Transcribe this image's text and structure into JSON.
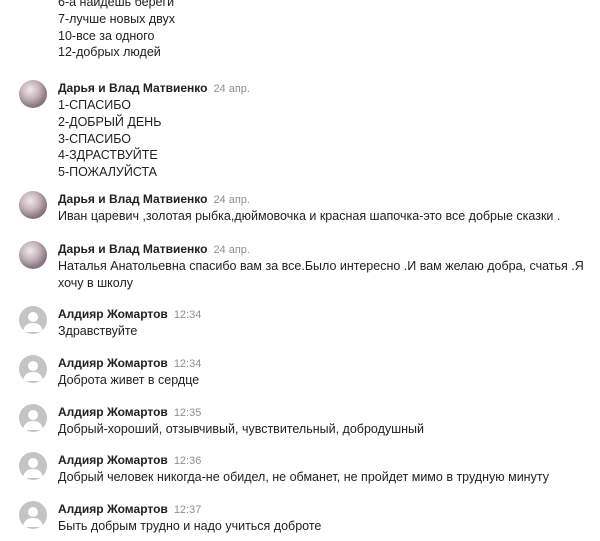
{
  "top_continuation": {
    "lines": [
      "6-а найдешь береги",
      "7-лучше новых двух",
      "10-все за одного",
      "12-добрых людей"
    ]
  },
  "comments": [
    {
      "author": "Дарья и Влад Матвиенко",
      "time": "24 апр.",
      "avatar": "photo-avatar",
      "lines": [
        "1-СПАСИБО",
        "2-ДОБРЫЙ ДЕНЬ",
        "3-СПАСИБО",
        "4-ЗДРАСТВУЙТЕ",
        "5-ПОЖАЛУЙСТА"
      ]
    },
    {
      "author": "Дарья и Влад Матвиенко",
      "time": "24 апр.",
      "avatar": "photo-avatar",
      "lines": [
        "Иван царевич ,золотая рыбка,дюймовочка и красная шапочка-это все добрые сказки ."
      ]
    },
    {
      "author": "Дарья и Влад Матвиенко",
      "time": "24 апр.",
      "avatar": "photo-avatar",
      "lines": [
        "Наталья Анатольевна спасибо вам за все.Было интересно .И вам желаю добра, счатья .Я хочу в школу"
      ]
    },
    {
      "author": "Алдияр Жомартов",
      "time": "12:34",
      "avatar": "default-user-avatar",
      "lines": [
        "Здравствуйте"
      ]
    },
    {
      "author": "Алдияр Жомартов",
      "time": "12:34",
      "avatar": "default-user-avatar",
      "lines": [
        "Доброта живет в сердце"
      ]
    },
    {
      "author": "Алдияр Жомартов",
      "time": "12:35",
      "avatar": "default-user-avatar",
      "lines": [
        "Добрый-хороший, отзывчивый, чувствительный, добродушный"
      ]
    },
    {
      "author": "Алдияр Жомартов",
      "time": "12:36",
      "avatar": "default-user-avatar",
      "lines": [
        "Добрый человек никогда-не обидел, не обманет, не пройдет мимо в трудную минуту"
      ]
    },
    {
      "author": "Алдияр Жомартов",
      "time": "12:37",
      "avatar": "default-user-avatar",
      "lines": [
        "Быть добрым трудно и надо учиться доброте"
      ]
    }
  ],
  "colors": {
    "text": "#212121",
    "timestamp": "#8f8f8f",
    "default_avatar": "#c4c4c4"
  }
}
